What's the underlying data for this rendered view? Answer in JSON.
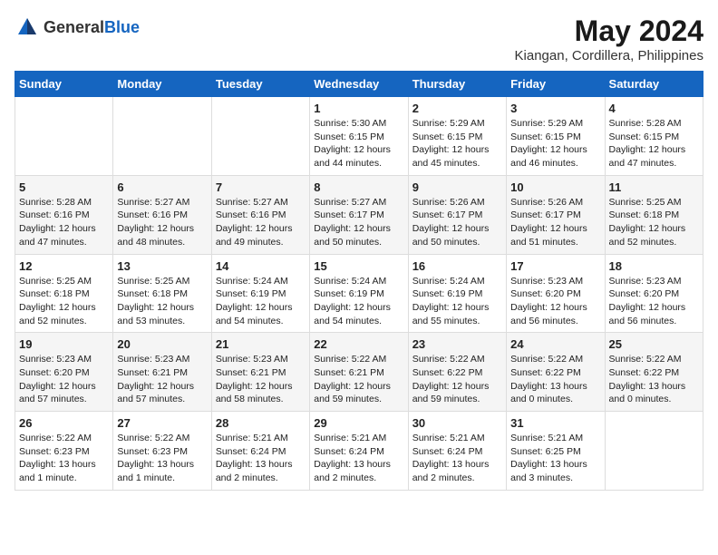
{
  "header": {
    "logo_general": "General",
    "logo_blue": "Blue",
    "title": "May 2024",
    "subtitle": "Kiangan, Cordillera, Philippines"
  },
  "weekdays": [
    "Sunday",
    "Monday",
    "Tuesday",
    "Wednesday",
    "Thursday",
    "Friday",
    "Saturday"
  ],
  "weeks": [
    [
      {
        "day": "",
        "info": ""
      },
      {
        "day": "",
        "info": ""
      },
      {
        "day": "",
        "info": ""
      },
      {
        "day": "1",
        "info": "Sunrise: 5:30 AM\nSunset: 6:15 PM\nDaylight: 12 hours\nand 44 minutes."
      },
      {
        "day": "2",
        "info": "Sunrise: 5:29 AM\nSunset: 6:15 PM\nDaylight: 12 hours\nand 45 minutes."
      },
      {
        "day": "3",
        "info": "Sunrise: 5:29 AM\nSunset: 6:15 PM\nDaylight: 12 hours\nand 46 minutes."
      },
      {
        "day": "4",
        "info": "Sunrise: 5:28 AM\nSunset: 6:15 PM\nDaylight: 12 hours\nand 47 minutes."
      }
    ],
    [
      {
        "day": "5",
        "info": "Sunrise: 5:28 AM\nSunset: 6:16 PM\nDaylight: 12 hours\nand 47 minutes."
      },
      {
        "day": "6",
        "info": "Sunrise: 5:27 AM\nSunset: 6:16 PM\nDaylight: 12 hours\nand 48 minutes."
      },
      {
        "day": "7",
        "info": "Sunrise: 5:27 AM\nSunset: 6:16 PM\nDaylight: 12 hours\nand 49 minutes."
      },
      {
        "day": "8",
        "info": "Sunrise: 5:27 AM\nSunset: 6:17 PM\nDaylight: 12 hours\nand 50 minutes."
      },
      {
        "day": "9",
        "info": "Sunrise: 5:26 AM\nSunset: 6:17 PM\nDaylight: 12 hours\nand 50 minutes."
      },
      {
        "day": "10",
        "info": "Sunrise: 5:26 AM\nSunset: 6:17 PM\nDaylight: 12 hours\nand 51 minutes."
      },
      {
        "day": "11",
        "info": "Sunrise: 5:25 AM\nSunset: 6:18 PM\nDaylight: 12 hours\nand 52 minutes."
      }
    ],
    [
      {
        "day": "12",
        "info": "Sunrise: 5:25 AM\nSunset: 6:18 PM\nDaylight: 12 hours\nand 52 minutes."
      },
      {
        "day": "13",
        "info": "Sunrise: 5:25 AM\nSunset: 6:18 PM\nDaylight: 12 hours\nand 53 minutes."
      },
      {
        "day": "14",
        "info": "Sunrise: 5:24 AM\nSunset: 6:19 PM\nDaylight: 12 hours\nand 54 minutes."
      },
      {
        "day": "15",
        "info": "Sunrise: 5:24 AM\nSunset: 6:19 PM\nDaylight: 12 hours\nand 54 minutes."
      },
      {
        "day": "16",
        "info": "Sunrise: 5:24 AM\nSunset: 6:19 PM\nDaylight: 12 hours\nand 55 minutes."
      },
      {
        "day": "17",
        "info": "Sunrise: 5:23 AM\nSunset: 6:20 PM\nDaylight: 12 hours\nand 56 minutes."
      },
      {
        "day": "18",
        "info": "Sunrise: 5:23 AM\nSunset: 6:20 PM\nDaylight: 12 hours\nand 56 minutes."
      }
    ],
    [
      {
        "day": "19",
        "info": "Sunrise: 5:23 AM\nSunset: 6:20 PM\nDaylight: 12 hours\nand 57 minutes."
      },
      {
        "day": "20",
        "info": "Sunrise: 5:23 AM\nSunset: 6:21 PM\nDaylight: 12 hours\nand 57 minutes."
      },
      {
        "day": "21",
        "info": "Sunrise: 5:23 AM\nSunset: 6:21 PM\nDaylight: 12 hours\nand 58 minutes."
      },
      {
        "day": "22",
        "info": "Sunrise: 5:22 AM\nSunset: 6:21 PM\nDaylight: 12 hours\nand 59 minutes."
      },
      {
        "day": "23",
        "info": "Sunrise: 5:22 AM\nSunset: 6:22 PM\nDaylight: 12 hours\nand 59 minutes."
      },
      {
        "day": "24",
        "info": "Sunrise: 5:22 AM\nSunset: 6:22 PM\nDaylight: 13 hours\nand 0 minutes."
      },
      {
        "day": "25",
        "info": "Sunrise: 5:22 AM\nSunset: 6:22 PM\nDaylight: 13 hours\nand 0 minutes."
      }
    ],
    [
      {
        "day": "26",
        "info": "Sunrise: 5:22 AM\nSunset: 6:23 PM\nDaylight: 13 hours\nand 1 minute."
      },
      {
        "day": "27",
        "info": "Sunrise: 5:22 AM\nSunset: 6:23 PM\nDaylight: 13 hours\nand 1 minute."
      },
      {
        "day": "28",
        "info": "Sunrise: 5:21 AM\nSunset: 6:24 PM\nDaylight: 13 hours\nand 2 minutes."
      },
      {
        "day": "29",
        "info": "Sunrise: 5:21 AM\nSunset: 6:24 PM\nDaylight: 13 hours\nand 2 minutes."
      },
      {
        "day": "30",
        "info": "Sunrise: 5:21 AM\nSunset: 6:24 PM\nDaylight: 13 hours\nand 2 minutes."
      },
      {
        "day": "31",
        "info": "Sunrise: 5:21 AM\nSunset: 6:25 PM\nDaylight: 13 hours\nand 3 minutes."
      },
      {
        "day": "",
        "info": ""
      }
    ]
  ]
}
